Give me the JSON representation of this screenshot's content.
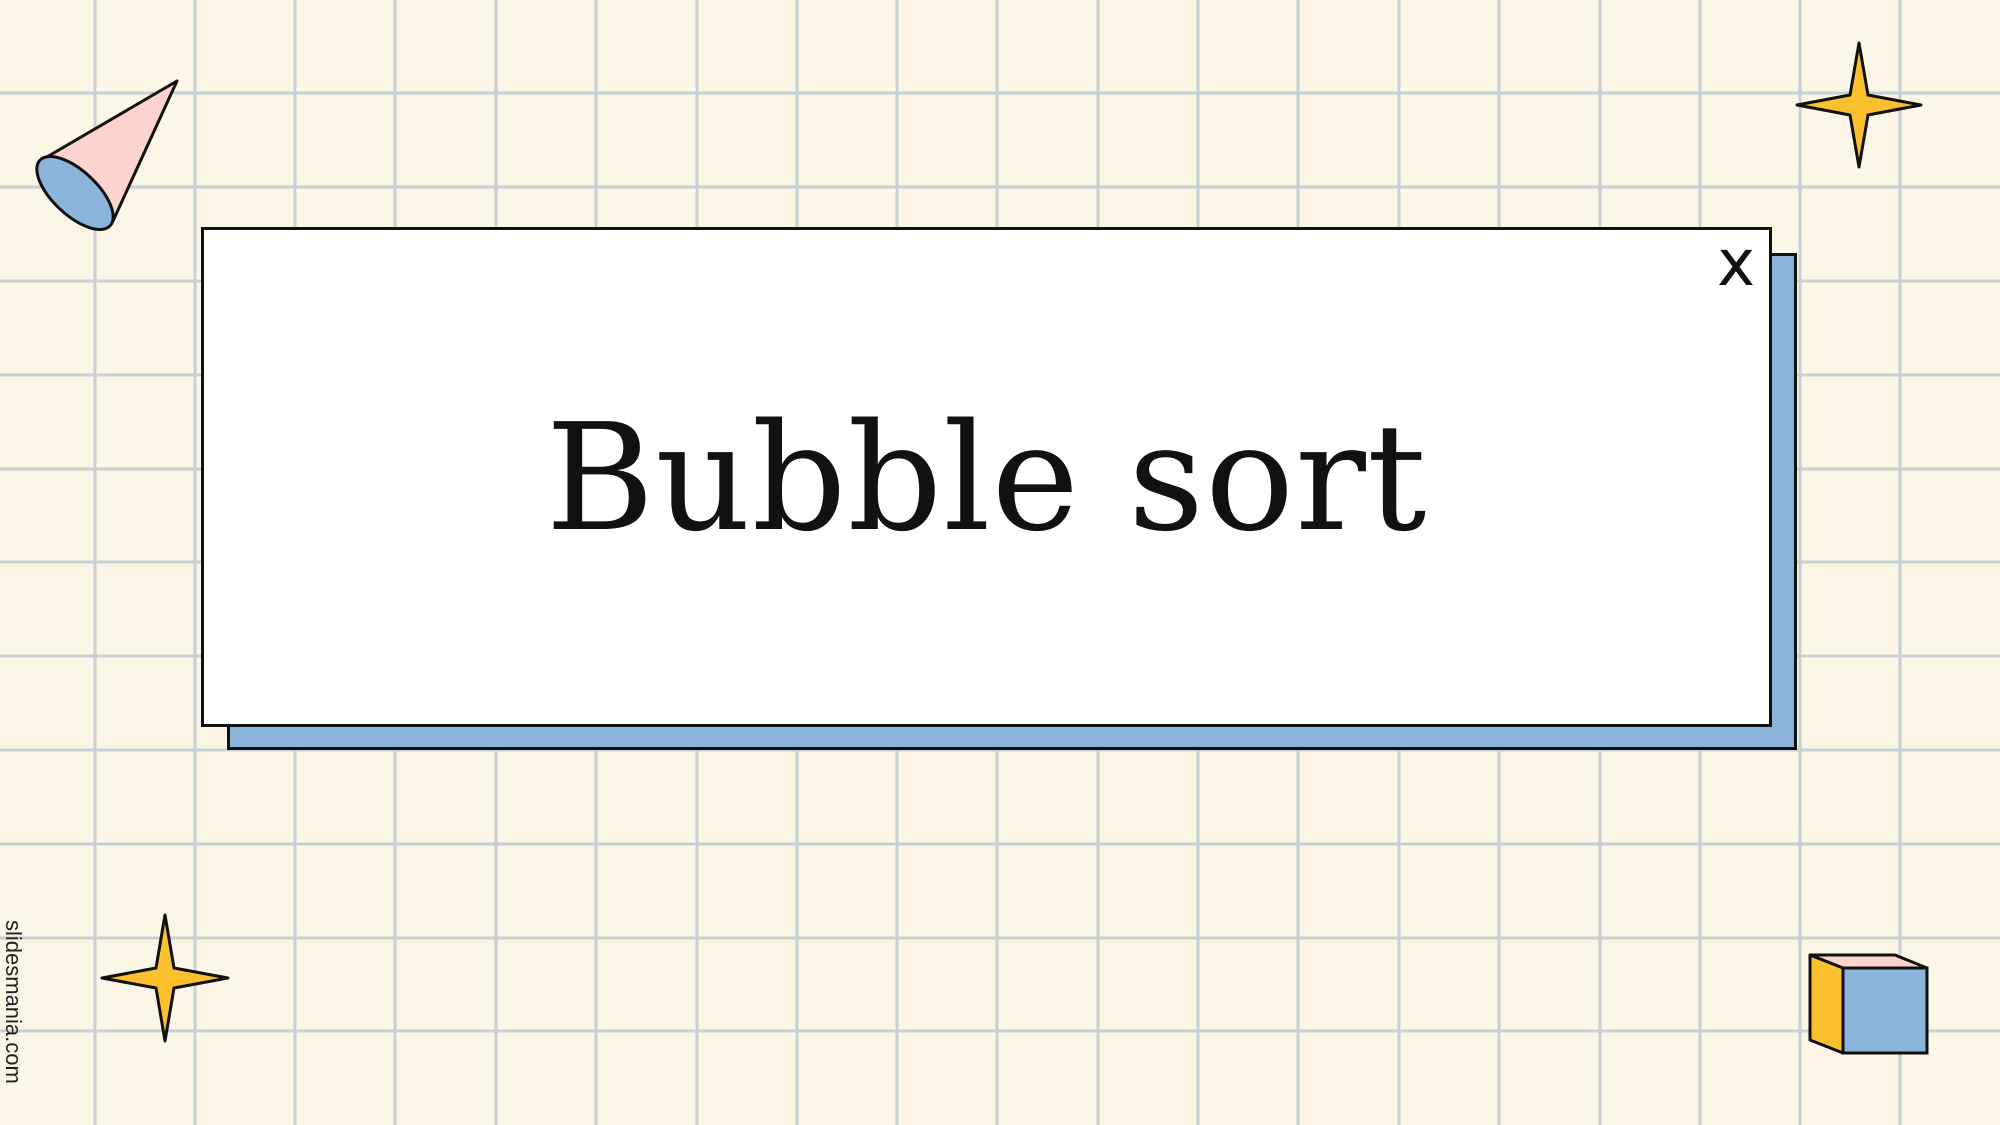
{
  "slide": {
    "title": "Bubble sort",
    "close_glyph": "x",
    "watermark": "slidesmania.com"
  },
  "colors": {
    "background": "#fcf6e7",
    "grid_line": "#c8d0d4",
    "card": "#ffffff",
    "shadow": "#8ab4da",
    "star": "#fbc02d",
    "cone_pink": "#fdd3ce",
    "cone_blue": "#8ab4da",
    "cube_yellow": "#fbc02d",
    "cube_blue": "#8ab4da",
    "cube_pink": "#fdd3ce",
    "outline": "#111111"
  },
  "icons": {
    "top_left": "cone-icon",
    "top_right": "sparkle-star-icon",
    "bottom_left": "sparkle-star-icon",
    "bottom_right": "cube-icon"
  }
}
